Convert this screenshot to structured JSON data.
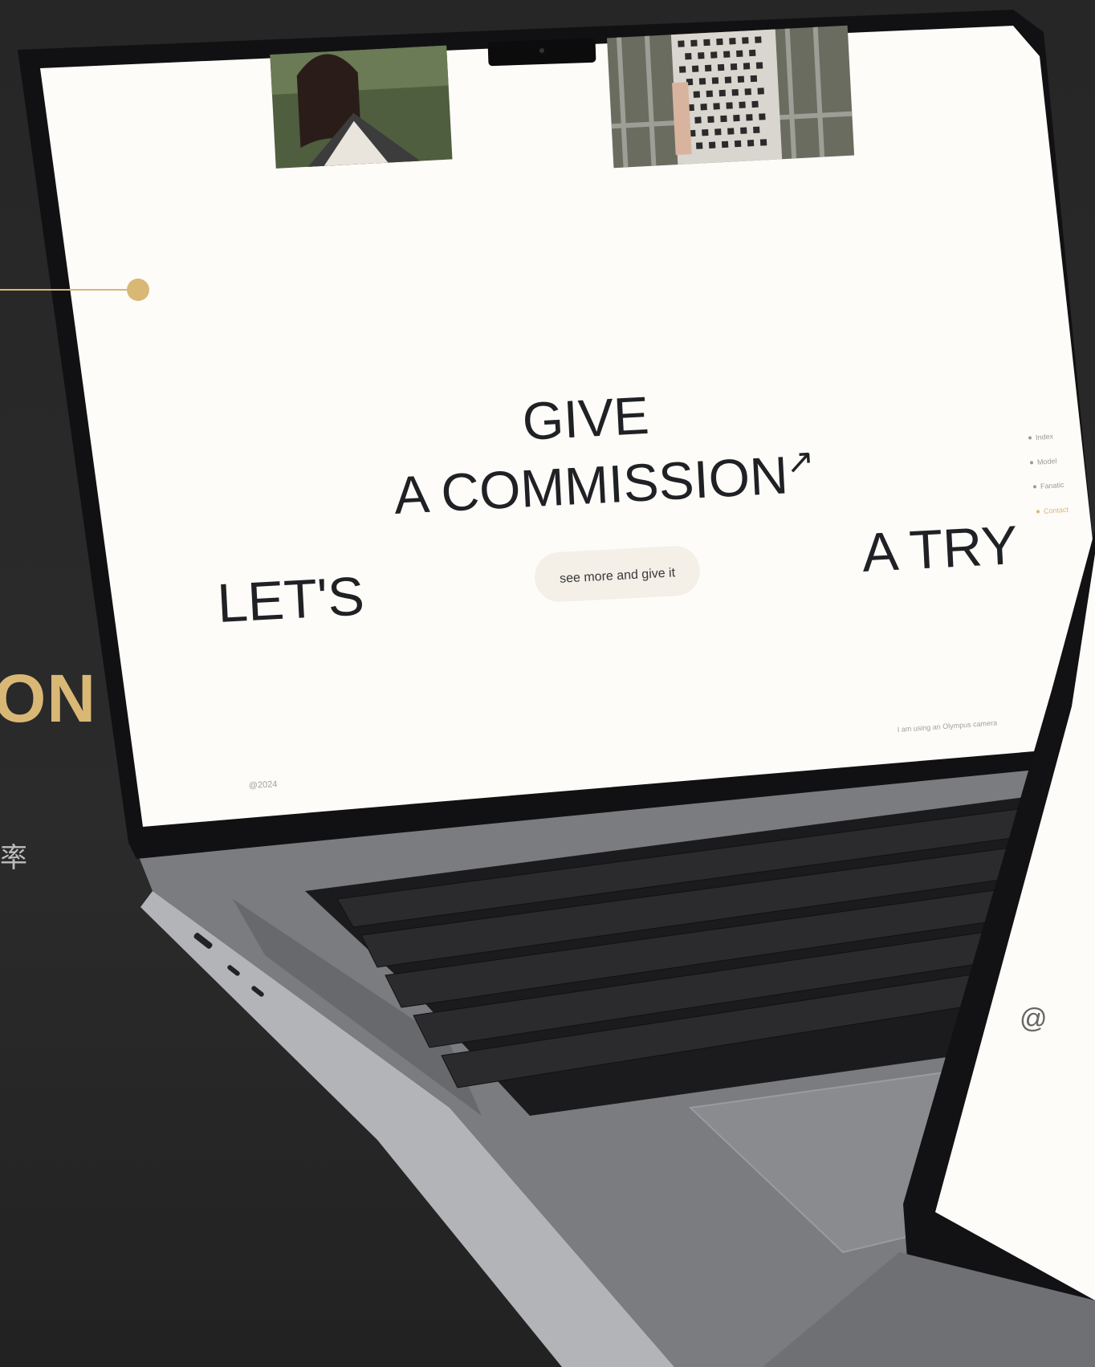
{
  "colors": {
    "background": "#2a2a2a",
    "accent_gold": "#d9b876",
    "screen_white": "#fdfcf9",
    "text_dark": "#1f2124",
    "button_bg": "#f4efe7"
  },
  "left_panel": {
    "heading_partial": "ON",
    "sub_partial": "率"
  },
  "website": {
    "headline_give": "GIVE",
    "headline_commission": "A COMMISSION",
    "arrow": "↗",
    "lets": "LET'S",
    "a_try": "A TRY",
    "cta_button": "see more and give it",
    "side_nav": [
      "Index",
      "Model",
      "Fanatic",
      "Contact"
    ],
    "footer_right": "I am using an Olympus camera",
    "footer_left": "@2024"
  },
  "tablet": {
    "at_symbol": "@"
  }
}
